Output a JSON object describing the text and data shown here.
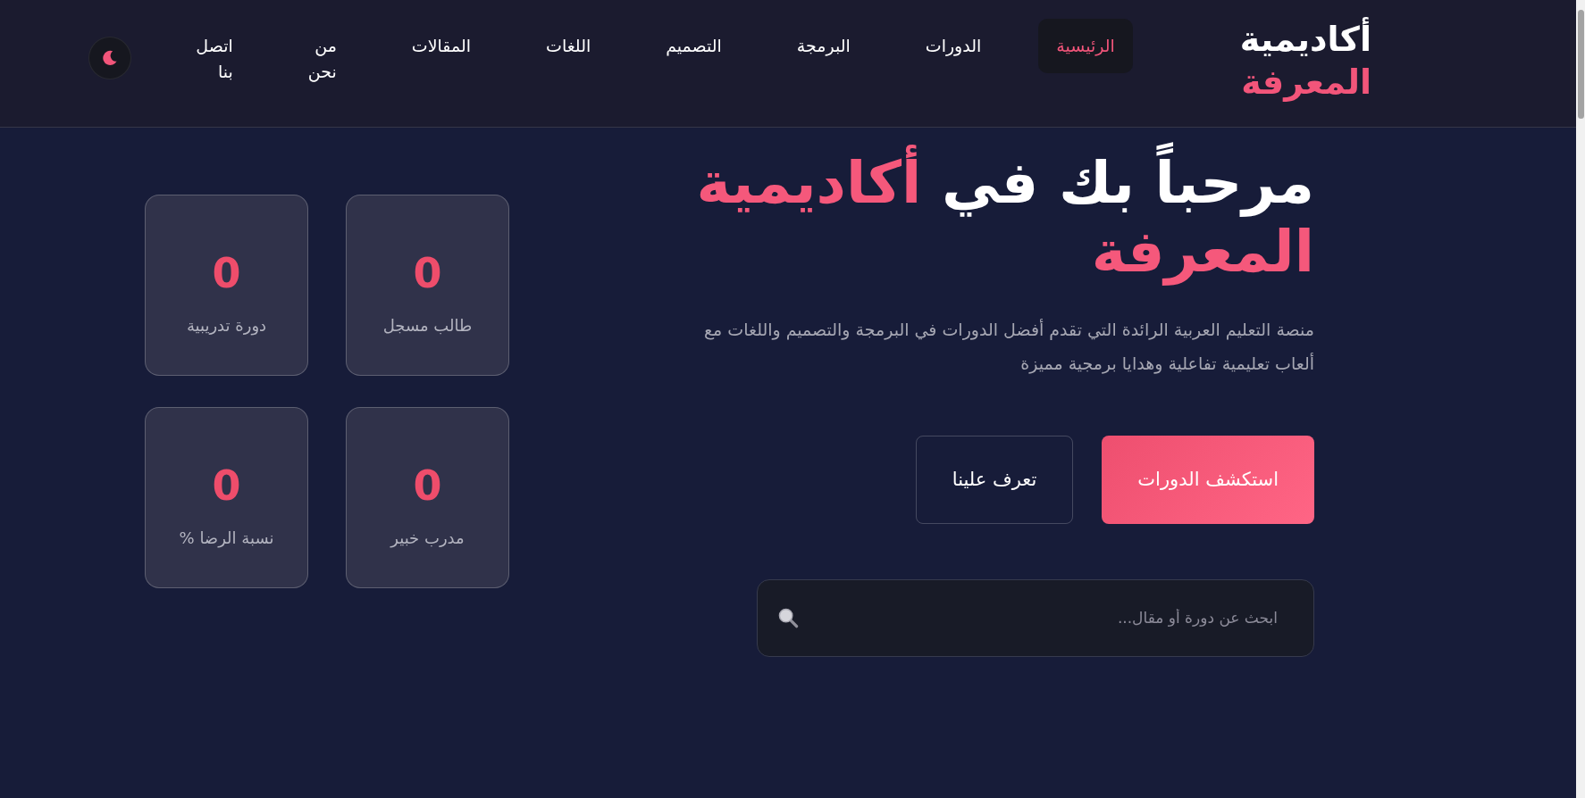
{
  "brand": {
    "name": "أكاديمية",
    "highlight": "المعرفة"
  },
  "nav": [
    {
      "label": "الرئيسية",
      "selected": true
    },
    {
      "label": "الدورات",
      "selected": false
    },
    {
      "label": "البرمجة",
      "selected": false
    },
    {
      "label": "التصميم",
      "selected": false
    },
    {
      "label": "اللغات",
      "selected": false
    },
    {
      "label": "المقالات",
      "selected": false
    },
    {
      "label": "من نحن",
      "selected": false
    },
    {
      "label": "اتصل بنا",
      "selected": false
    }
  ],
  "hero": {
    "title": "مرحباً بك في",
    "title_highlight": "أكاديمية المعرفة",
    "description": "منصة التعليم العربية الرائدة التي تقدم أفضل الدورات في البرمجة والتصميم واللغات مع ألعاب تعليمية تفاعلية وهدايا برمجية مميزة",
    "buttons": [
      {
        "label": "استكشف الدورات",
        "kind": "primary"
      },
      {
        "label": "تعرف علينا",
        "kind": "outline"
      }
    ],
    "search": {
      "placeholder": "ابحث عن دورة أو مقال..."
    }
  },
  "stats": [
    {
      "value": "0",
      "label": "طالب مسجل"
    },
    {
      "value": "0",
      "label": "دورة تدريبية"
    },
    {
      "value": "0",
      "label": "مدرب خبير"
    },
    {
      "value": "0",
      "label": "نسبة الرضا %"
    }
  ]
}
